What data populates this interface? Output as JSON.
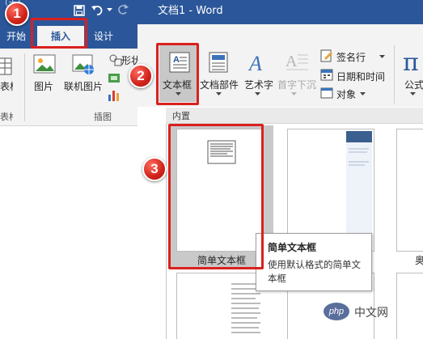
{
  "titlebar": {
    "title": "文档1 - Word",
    "partial_left": "(关)",
    "qat_icons": [
      "save-icon",
      "undo-icon",
      "redo-icon"
    ]
  },
  "tabs": [
    {
      "label": "开始",
      "partial": true
    },
    {
      "label": "插入",
      "active": true
    },
    {
      "label": "设计"
    }
  ],
  "ribbon": {
    "left_partial": "表格",
    "left_group_partial": "表格",
    "pictures": "图片",
    "online_pictures": "联机图片",
    "shapes_partial": "形状",
    "illustrations_group": "插图",
    "textbox": "文本框",
    "quickparts": "文档部件",
    "wordart": "艺术字",
    "dropcap": "首字下沉",
    "signature": "签名行",
    "datetime": "日期和时间",
    "object": "对象",
    "equation_partial": "公式"
  },
  "gallery": {
    "section": "内置",
    "items": [
      {
        "label": "简单文本框",
        "selected": true
      },
      {
        "label": ""
      },
      {
        "label": "奥"
      }
    ]
  },
  "tooltip": {
    "title": "简单文本框",
    "desc": "使用默认格式的简单文本框"
  },
  "callouts": [
    "1",
    "2",
    "3"
  ],
  "watermark": {
    "text": "中文网",
    "logo": "php"
  },
  "colors": {
    "word_blue": "#2b579a",
    "callout_red": "#d9211f"
  }
}
